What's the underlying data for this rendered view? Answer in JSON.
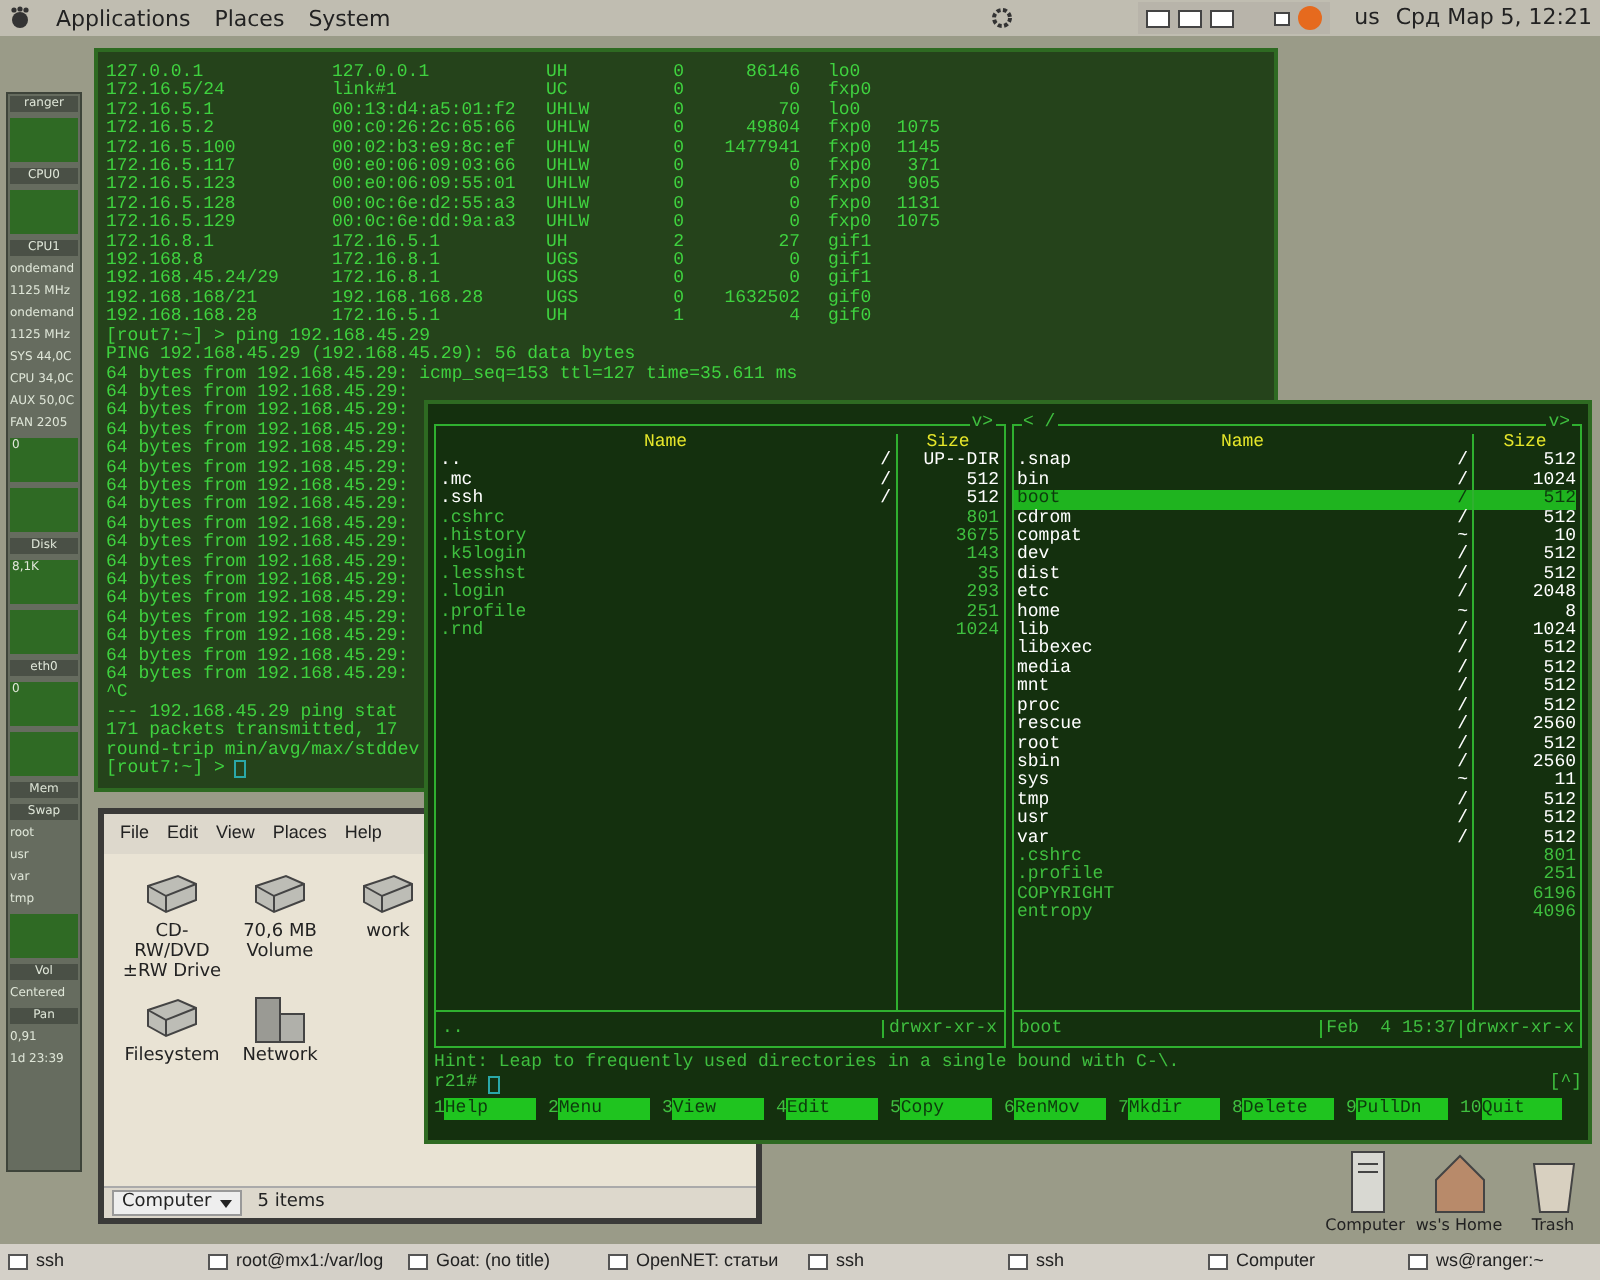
{
  "top_panel": {
    "menus": [
      "Applications",
      "Places",
      "System"
    ],
    "keyboard_layout": "us",
    "clock": "Срд Мар  5, 12:21"
  },
  "monitor": {
    "items": [
      {
        "kind": "label",
        "text": "ranger"
      },
      {
        "kind": "graph"
      },
      {
        "kind": "label",
        "text": "CPU0"
      },
      {
        "kind": "graph"
      },
      {
        "kind": "label",
        "text": "CPU1"
      },
      {
        "kind": "text",
        "text": "ondemand"
      },
      {
        "kind": "text",
        "text": "1125 MHz"
      },
      {
        "kind": "text",
        "text": "ondemand"
      },
      {
        "kind": "text",
        "text": "1125 MHz"
      },
      {
        "kind": "text",
        "text": "SYS 44,0C"
      },
      {
        "kind": "text",
        "text": "CPU 34,0C"
      },
      {
        "kind": "text",
        "text": "AUX 50,0C"
      },
      {
        "kind": "text",
        "text": "FAN 2205"
      },
      {
        "kind": "graph",
        "text": "0"
      },
      {
        "kind": "graph"
      },
      {
        "kind": "label",
        "text": "Disk"
      },
      {
        "kind": "graph",
        "text": "8,1K"
      },
      {
        "kind": "graph"
      },
      {
        "kind": "label",
        "text": "eth0"
      },
      {
        "kind": "graph",
        "text": "0"
      },
      {
        "kind": "graph"
      },
      {
        "kind": "label",
        "text": "Mem"
      },
      {
        "kind": "label",
        "text": "Swap"
      },
      {
        "kind": "text",
        "text": "root"
      },
      {
        "kind": "text",
        "text": "usr"
      },
      {
        "kind": "text",
        "text": "var"
      },
      {
        "kind": "text",
        "text": "tmp"
      },
      {
        "kind": "graph"
      },
      {
        "kind": "label",
        "text": "Vol"
      },
      {
        "kind": "text",
        "text": "Centered"
      },
      {
        "kind": "label",
        "text": "Pan"
      },
      {
        "kind": "text",
        "text": "0,91"
      },
      {
        "kind": "text",
        "text": "1d 23:39"
      }
    ]
  },
  "terminal": {
    "routes": [
      {
        "destination": "127.0.0.1",
        "gateway": "127.0.0.1",
        "flags": "UH",
        "refs": "0",
        "use": "86146",
        "netif": "lo0"
      },
      {
        "destination": "172.16.5/24",
        "gateway": "link#1",
        "flags": "UC",
        "refs": "0",
        "use": "0",
        "netif": "fxp0"
      },
      {
        "destination": "172.16.5.1",
        "gateway": "00:13:d4:a5:01:f2",
        "flags": "UHLW",
        "refs": "0",
        "use": "70",
        "netif": "lo0"
      },
      {
        "destination": "172.16.5.2",
        "gateway": "00:c0:26:2c:65:66",
        "flags": "UHLW",
        "refs": "0",
        "use": "49804",
        "netif": "fxp0",
        "expire": "1075"
      },
      {
        "destination": "172.16.5.100",
        "gateway": "00:02:b3:e9:8c:ef",
        "flags": "UHLW",
        "refs": "0",
        "use": "1477941",
        "netif": "fxp0",
        "expire": "1145"
      },
      {
        "destination": "172.16.5.117",
        "gateway": "00:e0:06:09:03:66",
        "flags": "UHLW",
        "refs": "0",
        "use": "0",
        "netif": "fxp0",
        "expire": "371"
      },
      {
        "destination": "172.16.5.123",
        "gateway": "00:e0:06:09:55:01",
        "flags": "UHLW",
        "refs": "0",
        "use": "0",
        "netif": "fxp0",
        "expire": "905"
      },
      {
        "destination": "172.16.5.128",
        "gateway": "00:0c:6e:d2:55:a3",
        "flags": "UHLW",
        "refs": "0",
        "use": "0",
        "netif": "fxp0",
        "expire": "1131"
      },
      {
        "destination": "172.16.5.129",
        "gateway": "00:0c:6e:dd:9a:a3",
        "flags": "UHLW",
        "refs": "0",
        "use": "0",
        "netif": "fxp0",
        "expire": "1075"
      },
      {
        "destination": "172.16.8.1",
        "gateway": "172.16.5.1",
        "flags": "UH",
        "refs": "2",
        "use": "27",
        "netif": "gif1"
      },
      {
        "destination": "192.168.8",
        "gateway": "172.16.8.1",
        "flags": "UGS",
        "refs": "0",
        "use": "0",
        "netif": "gif1"
      },
      {
        "destination": "192.168.45.24/29",
        "gateway": "172.16.8.1",
        "flags": "UGS",
        "refs": "0",
        "use": "0",
        "netif": "gif1"
      },
      {
        "destination": "192.168.168/21",
        "gateway": "192.168.168.28",
        "flags": "UGS",
        "refs": "0",
        "use": "1632502",
        "netif": "gif0"
      },
      {
        "destination": "192.168.168.28",
        "gateway": "172.16.5.1",
        "flags": "UH",
        "refs": "1",
        "use": "4",
        "netif": "gif0"
      }
    ],
    "lines": [
      "[rout7:~] > ping 192.168.45.29",
      "PING 192.168.45.29 (192.168.45.29): 56 data bytes",
      "64 bytes from 192.168.45.29: icmp_seq=153 ttl=127 time=35.611 ms",
      "64 bytes from 192.168.45.29:",
      "64 bytes from 192.168.45.29:",
      "64 bytes from 192.168.45.29:",
      "64 bytes from 192.168.45.29:",
      "64 bytes from 192.168.45.29:",
      "64 bytes from 192.168.45.29:",
      "64 bytes from 192.168.45.29:",
      "64 bytes from 192.168.45.29:",
      "64 bytes from 192.168.45.29:",
      "64 bytes from 192.168.45.29:",
      "64 bytes from 192.168.45.29:",
      "64 bytes from 192.168.45.29:",
      "64 bytes from 192.168.45.29:",
      "64 bytes from 192.168.45.29:",
      "64 bytes from 192.168.45.29:",
      "64 bytes from 192.168.45.29:",
      "^C",
      "--- 192.168.45.29 ping stat",
      "171 packets transmitted, 17",
      "round-trip min/avg/max/stddev"
    ],
    "prompt": "[rout7:~] >"
  },
  "file_manager": {
    "menus": [
      "File",
      "Edit",
      "View",
      "Places",
      "Help"
    ],
    "icons": [
      {
        "kind": "drive",
        "label": "CD-RW/DVD ±RW Drive"
      },
      {
        "kind": "drive",
        "label": "70,6 MB Volume"
      },
      {
        "kind": "drive",
        "label": "work"
      },
      {
        "kind": "drive",
        "label": "Filesystem"
      },
      {
        "kind": "network",
        "label": "Network"
      }
    ],
    "location": "Computer",
    "status": "5 items"
  },
  "mc": {
    "panels": [
      {
        "header_right": "v>",
        "columns": [
          "Name",
          "Size"
        ],
        "entries": [
          {
            "name": "..",
            "mark": "/",
            "size": "UP--DIR",
            "kind": "dir",
            "selected": false
          },
          {
            "name": ".mc",
            "mark": "/",
            "size": "512",
            "kind": "dir",
            "selected": false
          },
          {
            "name": ".ssh",
            "mark": "/",
            "size": "512",
            "kind": "dir",
            "selected": false
          },
          {
            "name": ".cshrc",
            "size": "801",
            "kind": "file",
            "selected": false
          },
          {
            "name": ".history",
            "size": "3675",
            "kind": "file",
            "selected": false
          },
          {
            "name": ".k5login",
            "size": "143",
            "kind": "file",
            "selected": false
          },
          {
            "name": ".lesshst",
            "size": "35",
            "kind": "file",
            "selected": false
          },
          {
            "name": ".login",
            "size": "293",
            "kind": "file",
            "selected": false
          },
          {
            "name": ".profile",
            "size": "251",
            "kind": "file",
            "selected": false
          },
          {
            "name": ".rnd",
            "size": "1024",
            "kind": "file",
            "selected": false
          }
        ],
        "status": {
          "name": "..",
          "perms": "drwxr-xr-x"
        }
      },
      {
        "header_left": "< /",
        "header_right": "v>",
        "columns": [
          "Name",
          "Size"
        ],
        "entries": [
          {
            "name": ".snap",
            "mark": "/",
            "size": "512",
            "kind": "dir",
            "selected": false
          },
          {
            "name": "bin",
            "mark": "/",
            "size": "1024",
            "kind": "dir",
            "selected": false
          },
          {
            "name": "boot",
            "mark": "/",
            "size": "512",
            "kind": "dir",
            "selected": true
          },
          {
            "name": "cdrom",
            "mark": "/",
            "size": "512",
            "kind": "dir",
            "selected": false
          },
          {
            "name": "compat",
            "mark": "~",
            "size": "10",
            "kind": "dir",
            "selected": false
          },
          {
            "name": "dev",
            "mark": "/",
            "size": "512",
            "kind": "dir",
            "selected": false
          },
          {
            "name": "dist",
            "mark": "/",
            "size": "512",
            "kind": "dir",
            "selected": false
          },
          {
            "name": "etc",
            "mark": "/",
            "size": "2048",
            "kind": "dir",
            "selected": false
          },
          {
            "name": "home",
            "mark": "~",
            "size": "8",
            "kind": "dir",
            "selected": false
          },
          {
            "name": "lib",
            "mark": "/",
            "size": "1024",
            "kind": "dir",
            "selected": false
          },
          {
            "name": "libexec",
            "mark": "/",
            "size": "512",
            "kind": "dir",
            "selected": false
          },
          {
            "name": "media",
            "mark": "/",
            "size": "512",
            "kind": "dir",
            "selected": false
          },
          {
            "name": "mnt",
            "mark": "/",
            "size": "512",
            "kind": "dir",
            "selected": false
          },
          {
            "name": "proc",
            "mark": "/",
            "size": "512",
            "kind": "dir",
            "selected": false
          },
          {
            "name": "rescue",
            "mark": "/",
            "size": "2560",
            "kind": "dir",
            "selected": false
          },
          {
            "name": "root",
            "mark": "/",
            "size": "512",
            "kind": "dir",
            "selected": false
          },
          {
            "name": "sbin",
            "mark": "/",
            "size": "2560",
            "kind": "dir",
            "selected": false
          },
          {
            "name": "sys",
            "mark": "~",
            "size": "11",
            "kind": "dir",
            "selected": false
          },
          {
            "name": "tmp",
            "mark": "/",
            "size": "512",
            "kind": "dir",
            "selected": false
          },
          {
            "name": "usr",
            "mark": "/",
            "size": "512",
            "kind": "dir",
            "selected": false
          },
          {
            "name": "var",
            "mark": "/",
            "size": "512",
            "kind": "dir",
            "selected": false
          },
          {
            "name": ".cshrc",
            "size": "801",
            "kind": "file",
            "selected": false
          },
          {
            "name": ".profile",
            "size": "251",
            "kind": "file",
            "selected": false
          },
          {
            "name": "COPYRIGHT",
            "size": "6196",
            "kind": "file",
            "selected": false
          },
          {
            "name": "entropy",
            "size": "4096",
            "kind": "file",
            "selected": false
          }
        ],
        "status": {
          "name": "boot",
          "date": "Feb  4 15:37",
          "perms": "drwxr-xr-x"
        }
      }
    ],
    "hint": "Hint: Leap to frequently used directories in a single bound with C-\\.",
    "prompt": "r21#",
    "scroll_mark": "[^]",
    "fkeys": [
      {
        "num": "1",
        "label": "Help"
      },
      {
        "num": "2",
        "label": "Menu"
      },
      {
        "num": "3",
        "label": "View"
      },
      {
        "num": "4",
        "label": "Edit"
      },
      {
        "num": "5",
        "label": "Copy"
      },
      {
        "num": "6",
        "label": "RenMov"
      },
      {
        "num": "7",
        "label": "Mkdir"
      },
      {
        "num": "8",
        "label": "Delete"
      },
      {
        "num": "9",
        "label": "PullDn"
      },
      {
        "num": "10",
        "label": "Quit"
      }
    ]
  },
  "desktop_icons": [
    {
      "kind": "computer",
      "label": "Computer"
    },
    {
      "kind": "home",
      "label": "ws's Home"
    },
    {
      "kind": "trash",
      "label": "Trash"
    }
  ],
  "taskbar": [
    {
      "label": "ssh"
    },
    {
      "label": "root@mx1:/var/log"
    },
    {
      "label": "Goat: (no title)"
    },
    {
      "label": "OpenNET: статьи"
    },
    {
      "label": "ssh"
    },
    {
      "label": "ssh"
    },
    {
      "label": "Computer"
    },
    {
      "label": "ws@ranger:~"
    }
  ]
}
